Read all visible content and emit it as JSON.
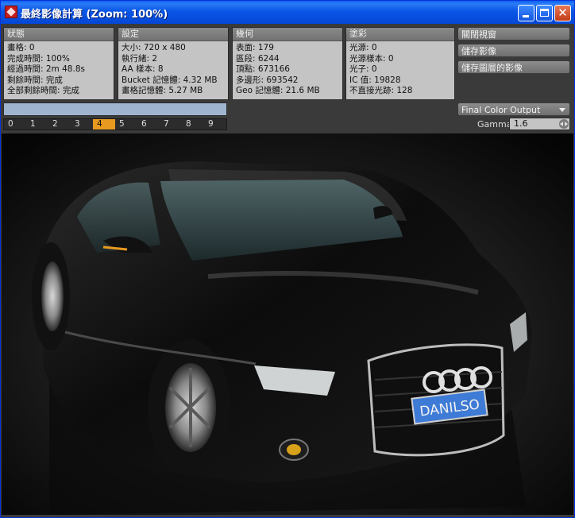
{
  "window": {
    "title": "最終影像計算 (Zoom: 100%)"
  },
  "panels": [
    {
      "title": "狀態",
      "lines": [
        "畫格: 0",
        "完成時間: 100%",
        "經過時間: 2m 48.8s",
        "剩餘時間: 完成",
        "全部剩餘時間: 完成"
      ]
    },
    {
      "title": "設定",
      "lines": [
        "大小: 720 x 480",
        "執行緒: 2",
        "AA 樣本: 8",
        "Bucket 記憶體: 4.32 MB",
        "畫格記憶體: 5.27 MB"
      ]
    },
    {
      "title": "幾何",
      "lines": [
        "表面: 179",
        "區段: 6244",
        "頂點: 673166",
        "多邊形: 693542",
        "Geo 記憶體: 21.6 MB"
      ]
    },
    {
      "title": "塗彩",
      "lines": [
        "光源: 0",
        "光源樣本: 0",
        "光子: 0",
        "IC 值: 19828",
        "不直接光跡: 128"
      ]
    }
  ],
  "side_buttons": [
    "關閉視窗",
    "儲存影像",
    "儲存圖層的影像"
  ],
  "output_select": {
    "value": "Final Color Output"
  },
  "gamma": {
    "label": "Gamma",
    "value": "1.6"
  },
  "progress": {
    "fraction": 1.0
  },
  "pages": {
    "items": [
      "0",
      "1",
      "2",
      "3",
      "4",
      "5",
      "6",
      "7",
      "8",
      "9"
    ],
    "active_index": 4
  },
  "render": {
    "plate_text": "DANILSO"
  },
  "colors": {
    "accent": "#e79a1f",
    "titlebar": "#0a56e6",
    "panel": "#c4c4c4"
  }
}
